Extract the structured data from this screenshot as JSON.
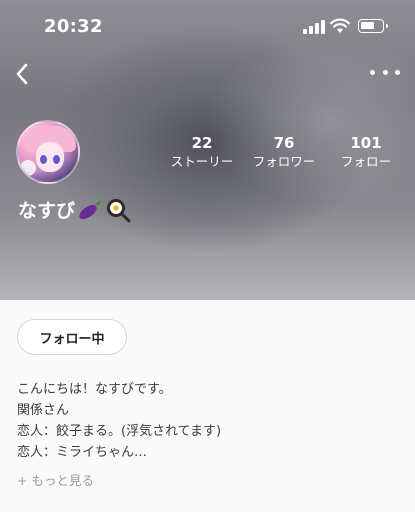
{
  "status_bar": {
    "time": "20:32"
  },
  "header": {
    "back_icon": "chevron-left-icon",
    "more_icon": "more-horizontal-icon"
  },
  "profile": {
    "name": "なすび",
    "name_emojis": [
      "eggplant-icon",
      "frying-pan-egg-icon"
    ],
    "stats": [
      {
        "count": "22",
        "label": "ストーリー"
      },
      {
        "count": "76",
        "label": "フォロワー"
      },
      {
        "count": "101",
        "label": "フォロー"
      }
    ]
  },
  "actions": {
    "follow_label": "フォロー中"
  },
  "bio": {
    "lines": [
      "こんにちは！なすびです。",
      "関係さん",
      "恋人：餃子まる。(浮気されてます)",
      "恋人：ミライちゃん…"
    ],
    "see_more": "+ もっと見る"
  },
  "colors": {
    "hero_gray": "#6b6b73",
    "text_white": "#ffffff",
    "eggplant": "#6a2c91"
  }
}
